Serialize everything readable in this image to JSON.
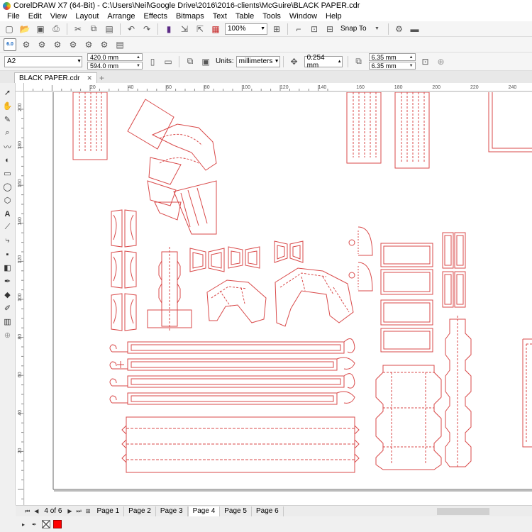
{
  "window": {
    "title": "CorelDRAW X7 (64-Bit) - C:\\Users\\Neil\\Google Drive\\2016\\2016-clients\\McGuire\\BLACK PAPER.cdr"
  },
  "menu": [
    "File",
    "Edit",
    "View",
    "Layout",
    "Arrange",
    "Effects",
    "Bitmaps",
    "Text",
    "Table",
    "Tools",
    "Window",
    "Help"
  ],
  "toolbar": {
    "zoom_value": "100%",
    "snap_label": "Snap To",
    "badge_text": "6.0"
  },
  "property_bar": {
    "paper_size": "A2",
    "width": "420.0 mm",
    "height": "594.0 mm",
    "units_label": "Units:",
    "units_value": "millimeters",
    "nudge": "0.254 mm",
    "dup_x": "6.35 mm",
    "dup_y": "6.35 mm"
  },
  "document_tab": "BLACK PAPER.cdr",
  "ruler": {
    "h_labels": [
      "20",
      "40",
      "60",
      "80",
      "100",
      "120",
      "140",
      "160",
      "180",
      "200",
      "220",
      "240"
    ],
    "v_labels": [
      "200",
      "180",
      "160",
      "140",
      "120",
      "100",
      "80",
      "60",
      "40",
      "20"
    ]
  },
  "pages": {
    "count_text": "4 of 6",
    "tabs": [
      "Page 1",
      "Page 2",
      "Page 3",
      "Page 4",
      "Page 5",
      "Page 6"
    ],
    "active_index": 3
  },
  "colors": {
    "outline": "#d94a4a",
    "fill_swatch": "#ff0000"
  }
}
